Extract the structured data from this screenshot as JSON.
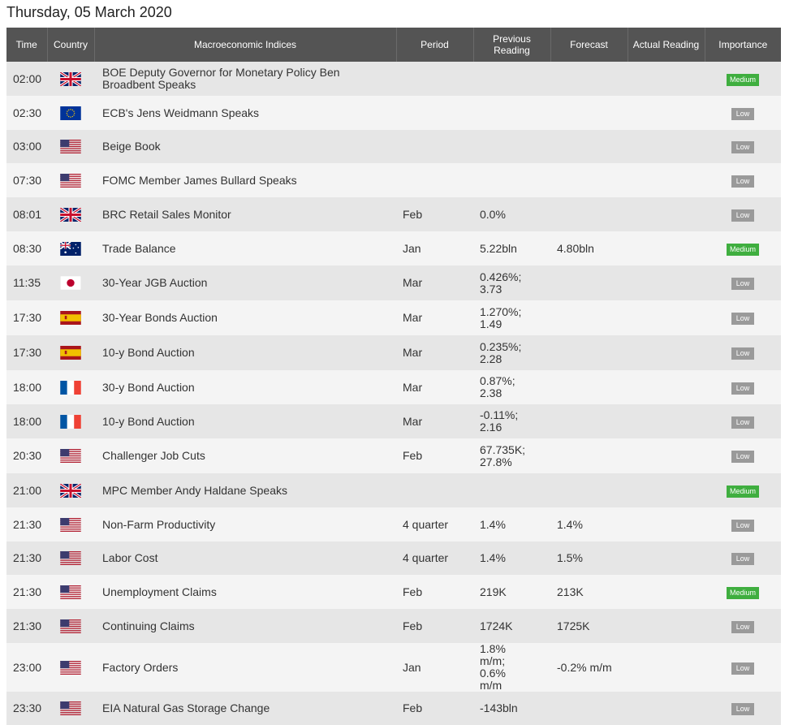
{
  "page": {
    "date_title": "Thursday, 05 March 2020"
  },
  "table": {
    "headers": {
      "time": "Time",
      "country": "Country",
      "indices": "Macroeconomic Indices",
      "period": "Period",
      "previous": "Previous Reading",
      "forecast": "Forecast",
      "actual": "Actual Reading",
      "importance": "Importance"
    },
    "rows": [
      {
        "time": "02:00",
        "country": "uk-flag-icon",
        "event": "BOE Deputy Governor for Monetary Policy Ben Broadbent Speaks",
        "period": "",
        "previous": "",
        "forecast": "",
        "actual": "",
        "importance": "Medium"
      },
      {
        "time": "02:30",
        "country": "eu-flag-icon",
        "event": "ECB's Jens Weidmann Speaks",
        "period": "",
        "previous": "",
        "forecast": "",
        "actual": "",
        "importance": "Low"
      },
      {
        "time": "03:00",
        "country": "us-flag-icon",
        "event": "Beige Book",
        "period": "",
        "previous": "",
        "forecast": "",
        "actual": "",
        "importance": "Low"
      },
      {
        "time": "07:30",
        "country": "us-flag-icon",
        "event": "FOMC Member James Bullard Speaks",
        "period": "",
        "previous": "",
        "forecast": "",
        "actual": "",
        "importance": "Low"
      },
      {
        "time": "08:01",
        "country": "uk-flag-icon",
        "event": "BRC Retail Sales Monitor",
        "period": "Feb",
        "previous": "0.0%",
        "forecast": "",
        "actual": "",
        "importance": "Low"
      },
      {
        "time": "08:30",
        "country": "au-flag-icon",
        "event": "Trade Balance",
        "period": "Jan",
        "previous": "5.22bln",
        "forecast": "4.80bln",
        "actual": "",
        "importance": "Medium"
      },
      {
        "time": "11:35",
        "country": "jp-flag-icon",
        "event": "30-Year JGB Auction",
        "period": "Mar",
        "previous": "0.426%; 3.73",
        "forecast": "",
        "actual": "",
        "importance": "Low"
      },
      {
        "time": "17:30",
        "country": "es-flag-icon",
        "event": "30-Year Bonds Auction",
        "period": "Mar",
        "previous": "1.270%; 1.49",
        "forecast": "",
        "actual": "",
        "importance": "Low"
      },
      {
        "time": "17:30",
        "country": "es-flag-icon",
        "event": "10-y Bond Auction",
        "period": "Mar",
        "previous": "0.235%; 2.28",
        "forecast": "",
        "actual": "",
        "importance": "Low"
      },
      {
        "time": "18:00",
        "country": "fr-flag-icon",
        "event": "30-y Bond Auction",
        "period": "Mar",
        "previous": "0.87%; 2.38",
        "forecast": "",
        "actual": "",
        "importance": "Low"
      },
      {
        "time": "18:00",
        "country": "fr-flag-icon",
        "event": "10-y Bond Auction",
        "period": "Mar",
        "previous": "-0.11%; 2.16",
        "forecast": "",
        "actual": "",
        "importance": "Low"
      },
      {
        "time": "20:30",
        "country": "us-flag-icon",
        "event": "Challenger Job Cuts",
        "period": "Feb",
        "previous": "67.735K; 27.8%",
        "forecast": "",
        "actual": "",
        "importance": "Low"
      },
      {
        "time": "21:00",
        "country": "uk-flag-icon",
        "event": "MPC Member Andy Haldane Speaks",
        "period": "",
        "previous": "",
        "forecast": "",
        "actual": "",
        "importance": "Medium"
      },
      {
        "time": "21:30",
        "country": "us-flag-icon",
        "event": "Non-Farm Productivity",
        "period": "4 quarter",
        "previous": "1.4%",
        "forecast": "1.4%",
        "actual": "",
        "importance": "Low"
      },
      {
        "time": "21:30",
        "country": "us-flag-icon",
        "event": "Labor Cost",
        "period": "4 quarter",
        "previous": "1.4%",
        "forecast": "1.5%",
        "actual": "",
        "importance": "Low"
      },
      {
        "time": "21:30",
        "country": "us-flag-icon",
        "event": "Unemployment Claims",
        "period": "Feb",
        "previous": "219K",
        "forecast": "213K",
        "actual": "",
        "importance": "Medium"
      },
      {
        "time": "21:30",
        "country": "us-flag-icon",
        "event": "Continuing Claims",
        "period": "Feb",
        "previous": "1724K",
        "forecast": "1725K",
        "actual": "",
        "importance": "Low"
      },
      {
        "time": "23:00",
        "country": "us-flag-icon",
        "event": "Factory Orders",
        "period": "Jan",
        "previous": "1.8% m/m; 0.6% m/m",
        "forecast": "-0.2% m/m",
        "actual": "",
        "importance": "Low"
      },
      {
        "time": "23:30",
        "country": "us-flag-icon",
        "event": "EIA Natural Gas Storage Change",
        "period": "Feb",
        "previous": "-143bln",
        "forecast": "",
        "actual": "",
        "importance": "Low"
      }
    ]
  },
  "colors": {
    "header_bg": "#545454",
    "row_odd": "#e6e6e6",
    "row_even": "#f4f4f4",
    "medium": "#3fae3f",
    "low": "#9a9a9a"
  }
}
